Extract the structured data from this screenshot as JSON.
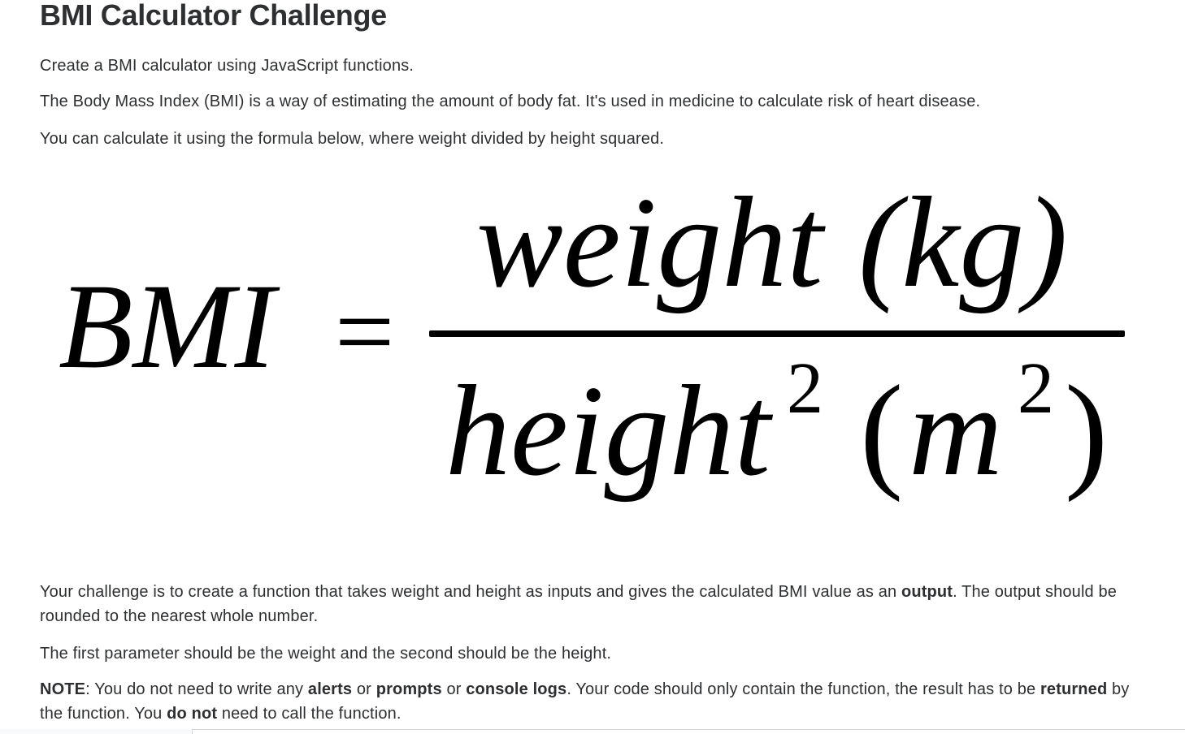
{
  "title": "BMI Calculator Challenge",
  "intro": {
    "line1": "Create a BMI calculator using JavaScript functions.",
    "line2": "The Body Mass Index (BMI) is a way of estimating the amount of body fat. It's used in medicine to calculate risk of heart disease.",
    "line3": "You can calculate it using the formula below, where weight divided by height squared."
  },
  "formula": {
    "lhs": "BMI",
    "equals": "=",
    "numerator_word": "weight",
    "numerator_unit": "(kg)",
    "denominator_word": "height",
    "denominator_exp": "2",
    "denominator_unit_open": "(",
    "denominator_unit": "m",
    "denominator_unit_exp": "2",
    "denominator_unit_close": ")"
  },
  "challenge": {
    "part1": "Your challenge is to create a function that takes weight and height as inputs and gives the calculated BMI value as an ",
    "bold_output": "output",
    "part2": ". The output should be rounded to the nearest whole number."
  },
  "params": "The first parameter should be the weight and the second should be the height.",
  "note": {
    "label": "NOTE",
    "t1": ": You do not need to write any ",
    "alerts": "alerts",
    "t2": " or ",
    "prompts": "prompts",
    "t3": " or ",
    "console_logs": "console logs",
    "t4": ". Your code should only contain the function, the result has to be ",
    "returned": "returned",
    "t5": " by the function. You ",
    "do_not": "do not",
    "t6": " need to call the function."
  }
}
